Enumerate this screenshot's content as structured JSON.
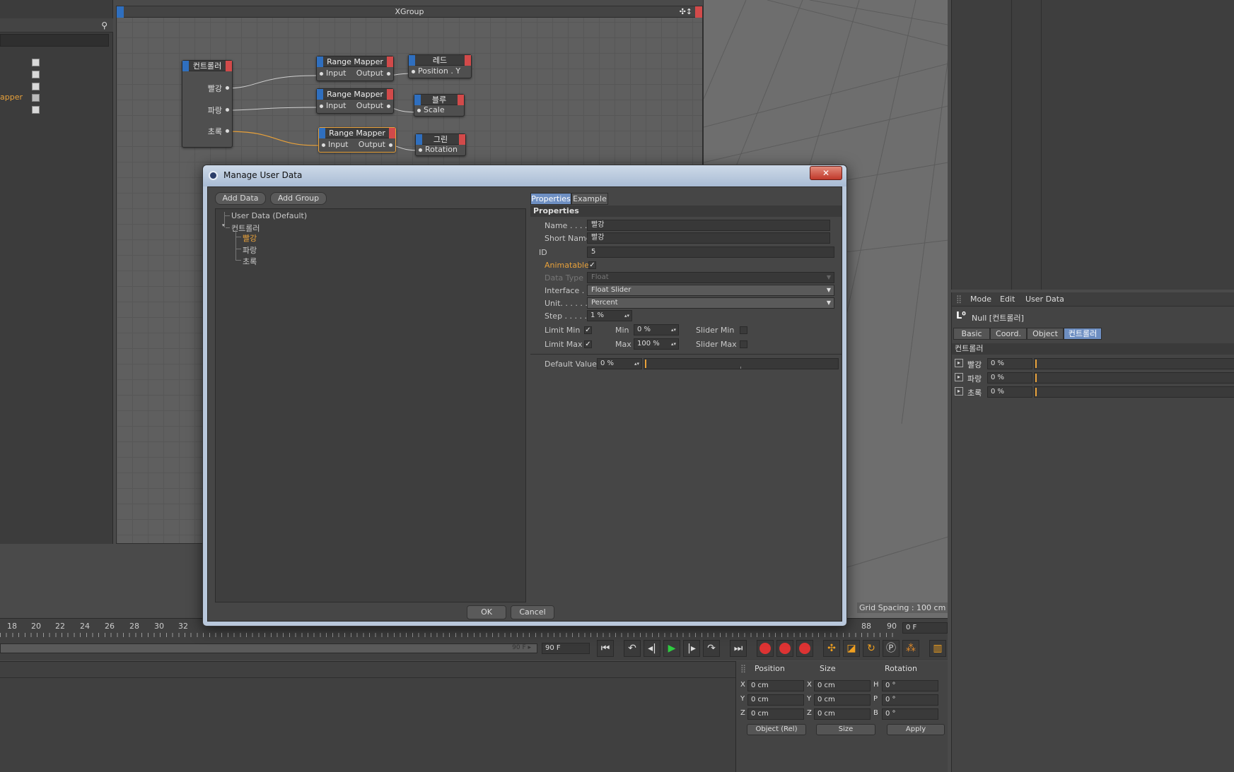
{
  "left_panel": {
    "items": [
      {
        "name": ""
      },
      {
        "name": ""
      },
      {
        "name": ""
      },
      {
        "name": "apper"
      },
      {
        "name": ""
      }
    ]
  },
  "xpresso": {
    "title": "XGroup",
    "move_icons": "✣↕",
    "nodes": {
      "controller": {
        "title": "컨트롤러",
        "ports": [
          "빨강",
          "파랑",
          "초록"
        ]
      },
      "mapper1": {
        "title": "Range Mapper",
        "in": "Input",
        "out": "Output"
      },
      "mapper2": {
        "title": "Range Mapper",
        "in": "Input",
        "out": "Output"
      },
      "mapper3": {
        "title": "Range Mapper",
        "in": "Input",
        "out": "Output"
      },
      "red": {
        "title": "레드",
        "port": "Position . Y"
      },
      "blue": {
        "title": "블루",
        "port": "Scale"
      },
      "green": {
        "title": "그린",
        "port": "Rotation"
      }
    }
  },
  "viewport": {
    "grid_spacing": "Grid Spacing : 100 cm"
  },
  "attributes": {
    "menu": [
      "Mode",
      "Edit",
      "User Data"
    ],
    "object_title": "Null [컨트롤러]",
    "tabs": [
      "Basic",
      "Coord.",
      "Object",
      "컨트롤러"
    ],
    "group_label": "컨트롤러",
    "rows": [
      {
        "label": "빨강",
        "value": "0 %",
        "level": 0
      },
      {
        "label": "파랑",
        "value": "0 %",
        "level": 0
      },
      {
        "label": "초록",
        "value": "0 %",
        "level": 0
      }
    ]
  },
  "timeline": {
    "ticks": [
      "18",
      "20",
      "22",
      "24",
      "26",
      "28",
      "30",
      "32",
      "88",
      "90"
    ],
    "current_frame": "0 F",
    "range_end_label": "90 F ▸",
    "end_frame": "90 F",
    "buttons": [
      "⏮",
      "↶",
      "◂|",
      "▶",
      "|▸",
      "↷",
      "⏭"
    ],
    "accent_play": "#2ecc40"
  },
  "coords": {
    "headers": [
      "Position",
      "Size",
      "Rotation"
    ],
    "rows": [
      {
        "ax1": "X",
        "pos": "0 cm",
        "ax2": "X",
        "size": "0 cm",
        "ax3": "H",
        "rot": "0 °"
      },
      {
        "ax1": "Y",
        "pos": "0 cm",
        "ax2": "Y",
        "size": "0 cm",
        "ax3": "P",
        "rot": "0 °"
      },
      {
        "ax1": "Z",
        "pos": "0 cm",
        "ax2": "Z",
        "size": "0 cm",
        "ax3": "B",
        "rot": "0 °"
      }
    ],
    "mode_select": "Object (Rel)",
    "size_select": "Size",
    "apply": "Apply"
  },
  "dialog": {
    "title": "Manage User Data",
    "close": "✕",
    "add_data": "Add Data",
    "add_group": "Add Group",
    "tree": {
      "root": "User Data (Default)",
      "group": "컨트롤러",
      "children": [
        "빨강",
        "파랑",
        "초록"
      ]
    },
    "tabs": [
      "Properties",
      "Example"
    ],
    "section": "Properties",
    "fields": {
      "name_label": "Name . . . . .",
      "name_value": "빨강",
      "short_label": "Short Name",
      "short_value": "빨강",
      "id_label": "ID",
      "id_value": "5",
      "animatable_label": "Animatable",
      "datatype_label": "Data Type",
      "datatype_value": "Float",
      "interface_label": "Interface . . .",
      "interface_value": "Float Slider",
      "unit_label": "Unit. . . . . . .",
      "unit_value": "Percent",
      "step_label": "Step . . . . . .",
      "step_value": "1 %",
      "limitmin_label": "Limit Min",
      "min_label": "Min",
      "min_value": "0 %",
      "slidermin_label": "Slider Min",
      "limitmax_label": "Limit Max",
      "max_label": "Max",
      "max_value": "100 %",
      "slidermax_label": "Slider Max",
      "default_label": "Default Value",
      "default_value": "0 %",
      "check": "✓"
    },
    "ok": "OK",
    "cancel": "Cancel"
  }
}
